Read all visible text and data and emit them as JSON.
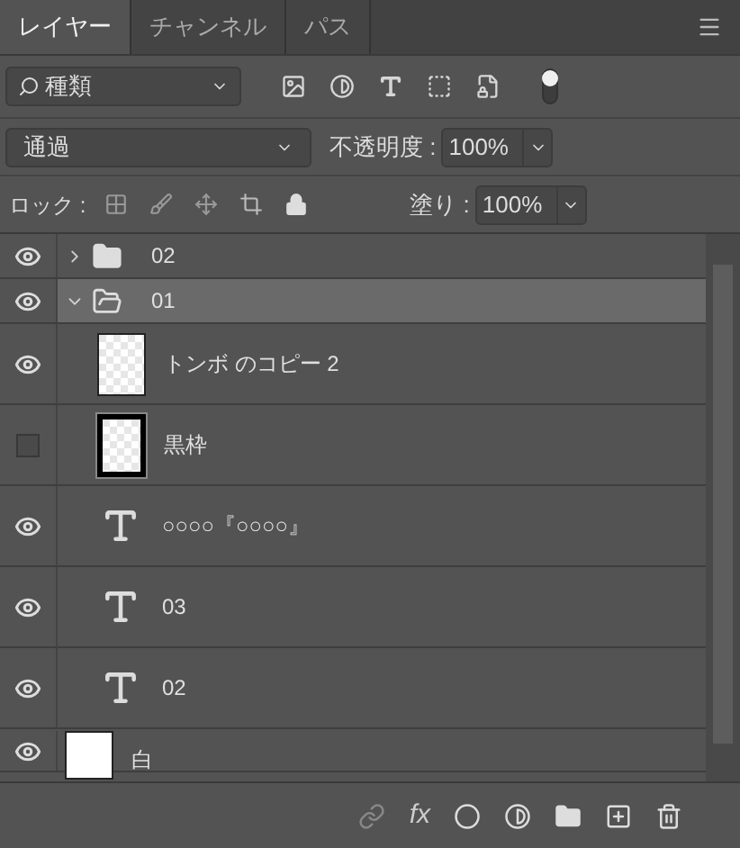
{
  "tabs": [
    {
      "label": "レイヤー",
      "selected": true
    },
    {
      "label": "チャンネル",
      "selected": false
    },
    {
      "label": "パス",
      "selected": false
    }
  ],
  "filter": {
    "value": "種類",
    "on": true
  },
  "blend": {
    "value": "通過",
    "opacity_label": "不透明度 :",
    "opacity": "100%"
  },
  "lock": {
    "label": "ロック :",
    "fill_label": "塗り :",
    "fill": "100%"
  },
  "layers": [
    {
      "name": "02",
      "kind": "group",
      "visible": true,
      "expanded": false,
      "selected": false
    },
    {
      "name": "01",
      "kind": "group",
      "visible": true,
      "expanded": true,
      "selected": true,
      "children": [
        {
          "name": "トンボ のコピー 2",
          "kind": "pixel",
          "visible": true,
          "selected": false
        },
        {
          "name": "黒枠",
          "kind": "frame",
          "visible": false,
          "selected": false
        },
        {
          "name": "○○○○『○○○○』",
          "kind": "text",
          "visible": true,
          "selected": false
        },
        {
          "name": "03",
          "kind": "text",
          "visible": true,
          "selected": false
        },
        {
          "name": "02",
          "kind": "text",
          "visible": true,
          "selected": false
        }
      ]
    },
    {
      "name": "白",
      "kind": "fill",
      "visible": true,
      "selected": false
    }
  ],
  "footer": {
    "fx_label": "fx"
  }
}
